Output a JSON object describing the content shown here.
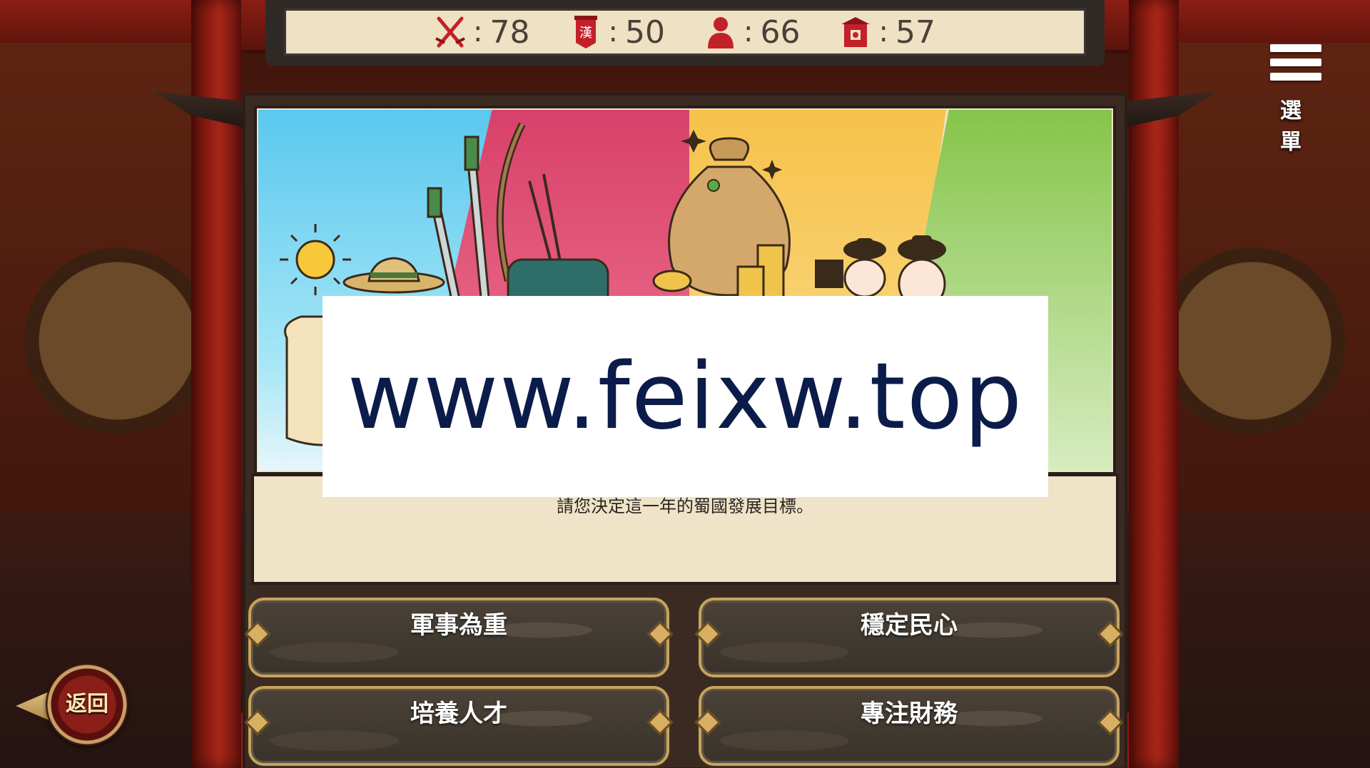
{
  "stats": [
    {
      "icon": "crossed-swords-icon",
      "value": "78",
      "color": "#c4202a"
    },
    {
      "icon": "han-banner-icon",
      "banner_text": "漢",
      "value": "50",
      "color": "#c4202a"
    },
    {
      "icon": "person-icon",
      "value": "66",
      "color": "#c4202a"
    },
    {
      "icon": "palace-icon",
      "value": "57",
      "color": "#c4202a"
    }
  ],
  "stat_separator": ":",
  "menu": {
    "label": "選 單"
  },
  "dialog": {
    "prompt": "請您決定這一年的蜀國發展目標。"
  },
  "watermark": "www.feixw.top",
  "choices": [
    {
      "label": "軍事為重"
    },
    {
      "label": "穩定民心"
    },
    {
      "label": "培養人才"
    },
    {
      "label": "專注財務"
    }
  ],
  "back": {
    "label": "返回"
  },
  "colors": {
    "stats_bar_bg": "#efe1c4",
    "stat_red": "#c4202a",
    "choice_border": "#c7a35c",
    "panel_blue": "#5ac8ee",
    "panel_pink": "#d8406a",
    "panel_yellow": "#f6c24a",
    "panel_green": "#86c44a"
  }
}
